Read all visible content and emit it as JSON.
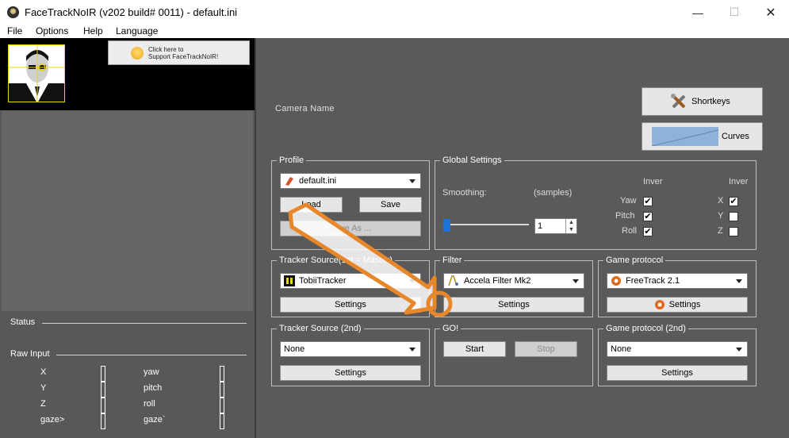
{
  "window": {
    "title": "FaceTrackNoIR (v202 build# 0011) - default.ini",
    "minimize_glyph": "—",
    "maximize_glyph": "☐",
    "close_glyph": "✕"
  },
  "menu": [
    "File",
    "Options",
    "Help",
    "Language"
  ],
  "support": {
    "line1": "Click here to",
    "line2": "Support FaceTrackNoIR!"
  },
  "left": {
    "status_label": "Status",
    "raw_input_label": "Raw Input",
    "raw_left": [
      {
        "name": "X",
        "value": "[]"
      },
      {
        "name": "Y",
        "value": "[]"
      },
      {
        "name": "Z",
        "value": "[]"
      },
      {
        "name": "gaze>",
        "value": "[]"
      }
    ],
    "raw_right": [
      {
        "name": "yaw",
        "value": "[]"
      },
      {
        "name": "pitch",
        "value": "[]"
      },
      {
        "name": "roll",
        "value": "[]"
      },
      {
        "name": "gaze`",
        "value": "[]"
      }
    ]
  },
  "camera_name_label": "Camera Name",
  "shortkeys_label": "Shortkeys",
  "curves_label": "Curves",
  "profile": {
    "title": "Profile",
    "selected": "default.ini",
    "load": "Load",
    "save": "Save",
    "save_as": "Save As ..."
  },
  "global_settings": {
    "title": "Global Settings",
    "smoothing_label": "Smoothing:",
    "samples_label": "(samples)",
    "smoothing_value": "1",
    "smoothing_level": 0.0,
    "invert_label_1": "Inver",
    "invert_label_2": "Inver",
    "rot_axes": [
      {
        "name": "Yaw",
        "checked": true
      },
      {
        "name": "Pitch",
        "checked": true
      },
      {
        "name": "Roll",
        "checked": true
      }
    ],
    "trans_axes": [
      {
        "name": "X",
        "checked": true
      },
      {
        "name": "Y",
        "checked": false
      },
      {
        "name": "Z",
        "checked": false
      }
    ]
  },
  "tracker1": {
    "title": "Tracker Source(1st = Master)",
    "selected": "TobiiTracker",
    "settings": "Settings"
  },
  "filter": {
    "title": "Filter",
    "selected": "Accela Filter Mk2",
    "settings": "Settings"
  },
  "protocol": {
    "title": "Game protocol",
    "selected": "FreeTrack 2.1",
    "settings": "Settings"
  },
  "tracker2": {
    "title": "Tracker Source (2nd)",
    "selected": "None",
    "settings": "Settings"
  },
  "go": {
    "title": "GO!",
    "start": "Start",
    "stop": "Stop"
  },
  "protocol2": {
    "title": "Game protocol (2nd)",
    "selected": "None",
    "settings": "Settings"
  },
  "colors": {
    "accent_arrow": "#e8862a",
    "background": "#5a5a5a",
    "overlay_face_line": "#e8d400"
  }
}
